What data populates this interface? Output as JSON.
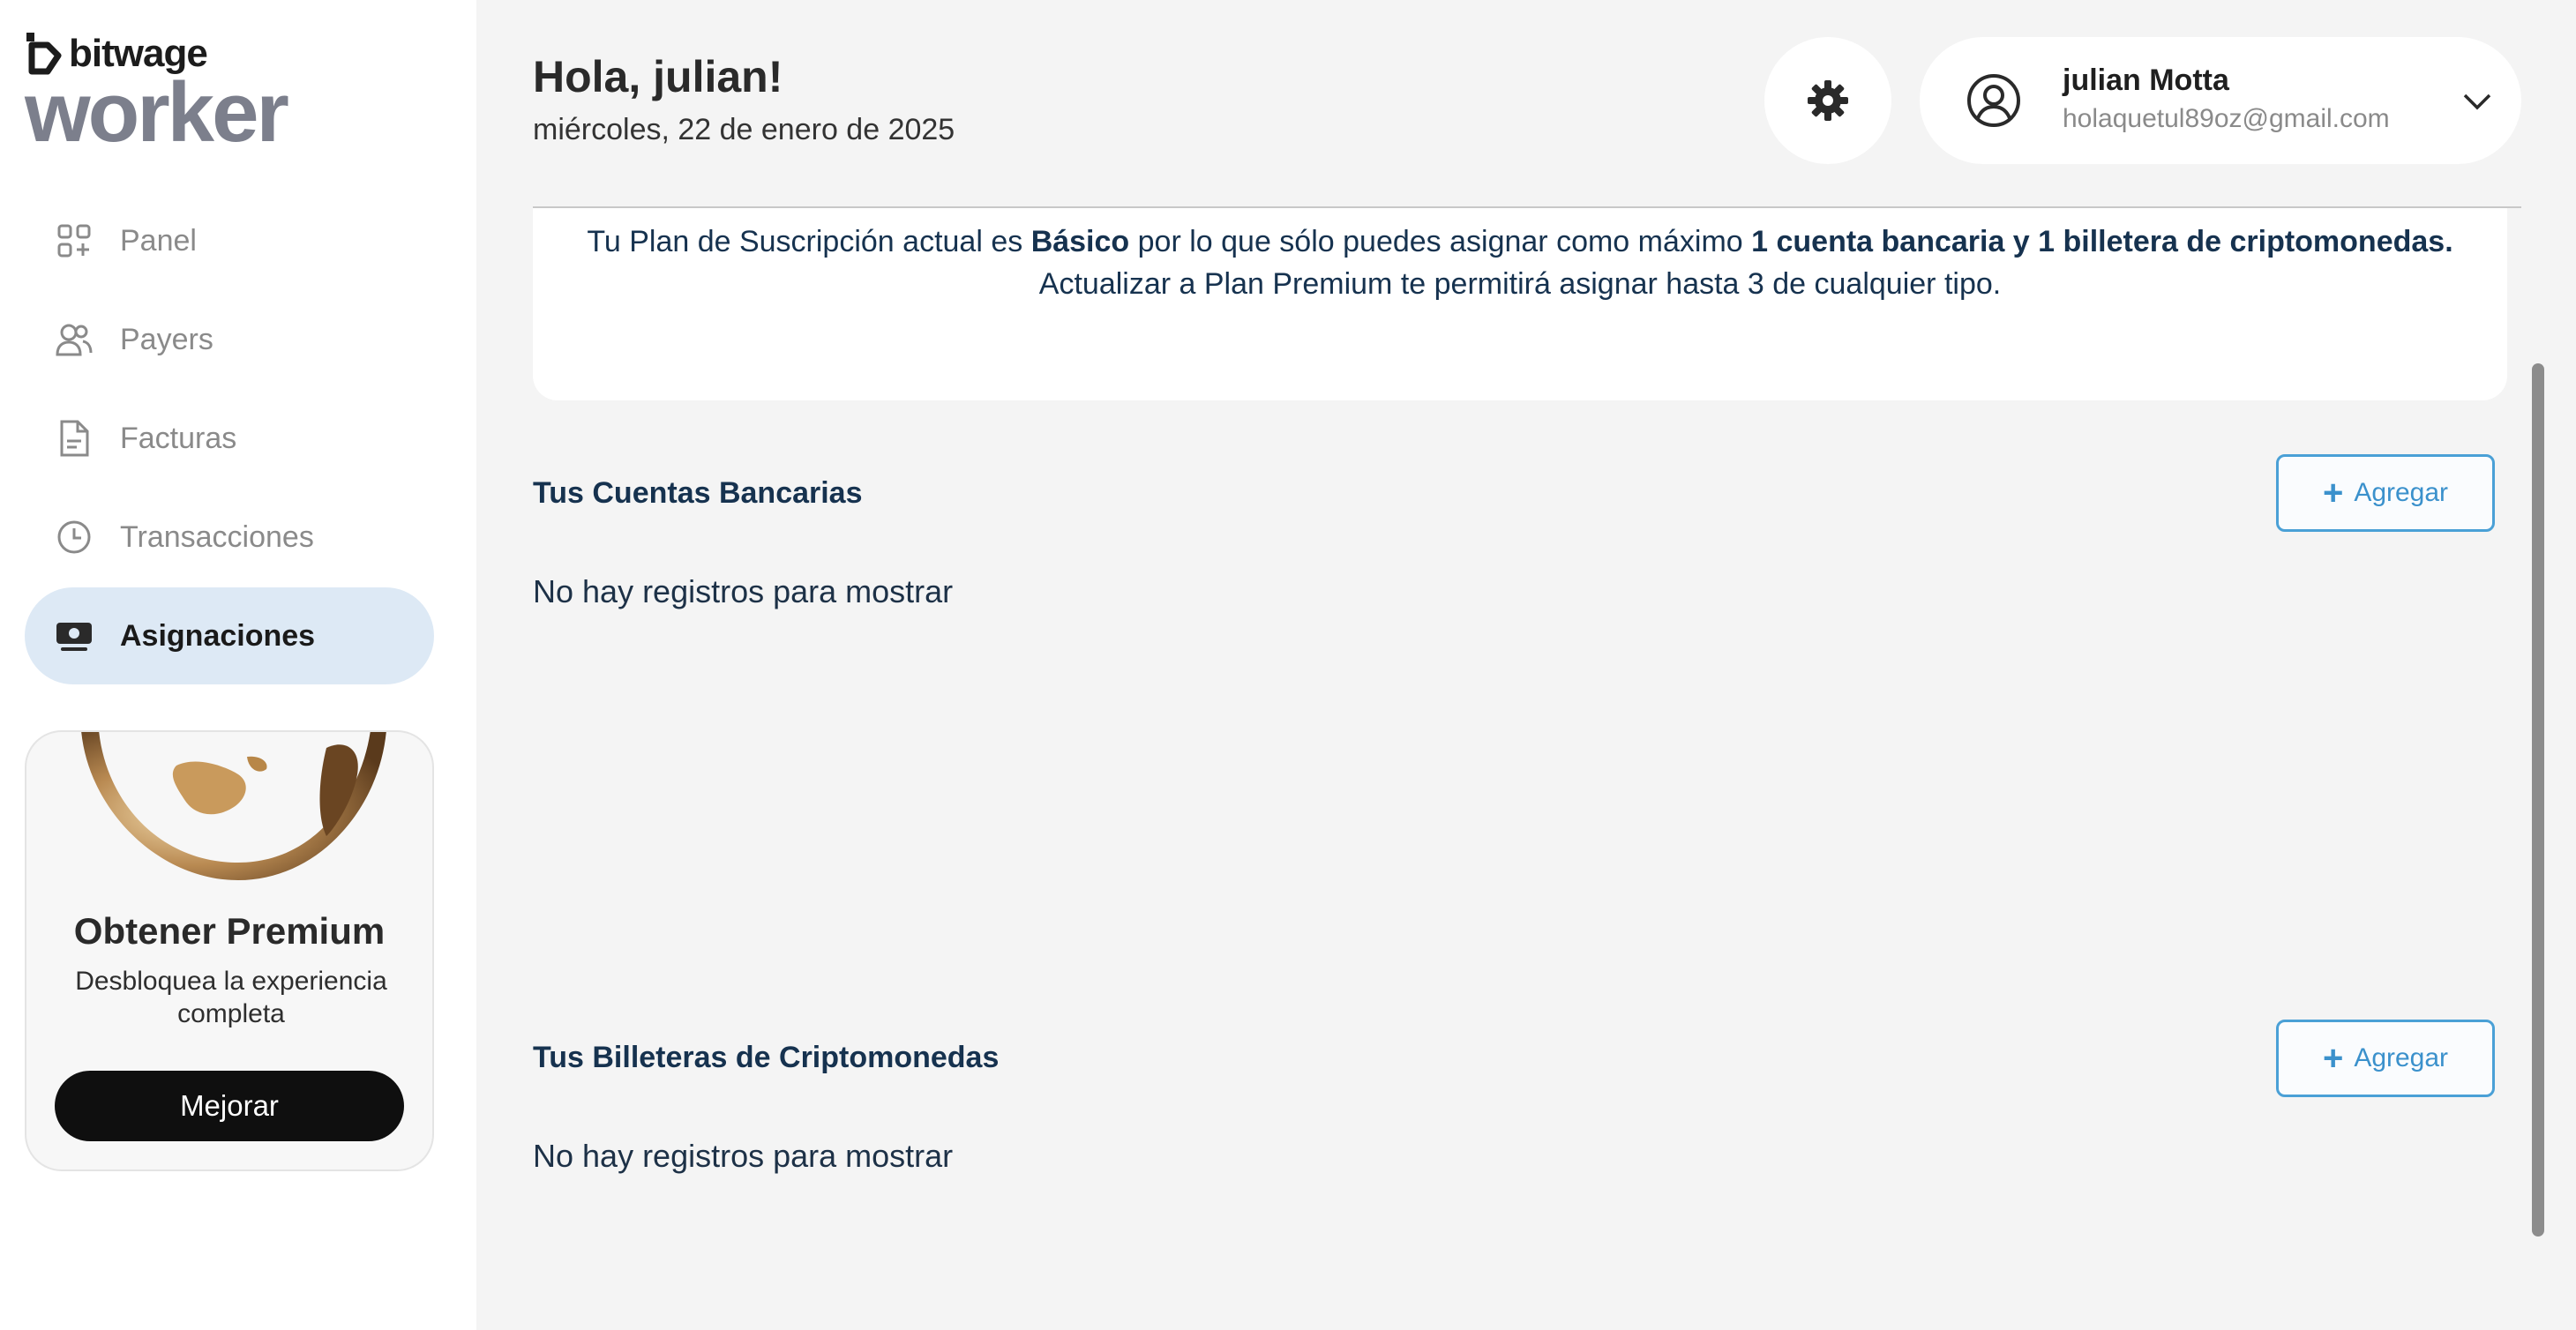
{
  "brand": {
    "name": "bitwage",
    "product": "worker"
  },
  "sidebar": {
    "items": [
      {
        "label": "Panel",
        "icon": "panel-icon",
        "active": false
      },
      {
        "label": "Payers",
        "icon": "users-icon",
        "active": false
      },
      {
        "label": "Facturas",
        "icon": "document-icon",
        "active": false
      },
      {
        "label": "Transacciones",
        "icon": "clock-icon",
        "active": false
      },
      {
        "label": "Asignaciones",
        "icon": "money-icon",
        "active": true
      }
    ],
    "premium": {
      "title": "Obtener Premium",
      "description": "Desbloquea la experiencia completa",
      "button": "Mejorar"
    }
  },
  "header": {
    "greeting": "Hola, julian!",
    "date": "miércoles, 22 de enero de 2025",
    "user": {
      "name": "julian Motta",
      "email": "holaquetul89oz@gmail.com"
    }
  },
  "notice": {
    "part1": "Tu Plan de Suscripción actual es ",
    "plan": "Básico",
    "part2": " por lo que sólo puedes asignar como máximo ",
    "limit": "1 cuenta bancaria y 1 billetera de criptomonedas.",
    "part3": " Actualizar a Plan Premium te permitirá asignar hasta 3 de cualquier tipo."
  },
  "sections": {
    "bank": {
      "title": "Tus Cuentas Bancarias",
      "empty": "No hay registros para mostrar",
      "add_label": "Agregar"
    },
    "crypto": {
      "title": "Tus Billeteras de Criptomonedas",
      "empty": "No hay registros para mostrar",
      "add_label": "Agregar"
    }
  },
  "colors": {
    "accent": "#3b91cc",
    "navActive": "#dde9f5",
    "heading": "#16324f"
  }
}
